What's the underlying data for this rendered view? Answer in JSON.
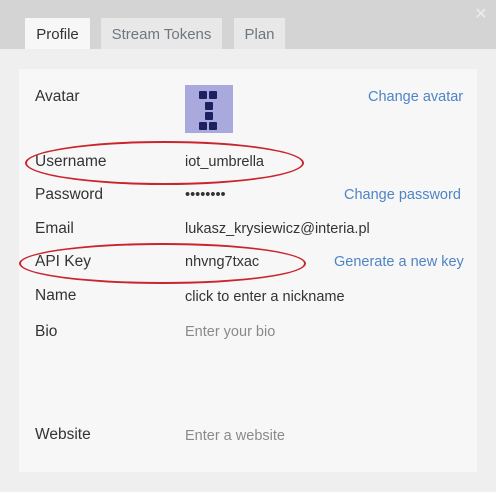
{
  "tabs": [
    "Profile",
    "Stream Tokens",
    "Plan"
  ],
  "close_icon": "close-icon",
  "fields": {
    "avatar": {
      "label": "Avatar",
      "action": "Change avatar"
    },
    "username": {
      "label": "Username",
      "value": "iot_umbrella"
    },
    "password": {
      "label": "Password",
      "value": "••••••••",
      "action": "Change password"
    },
    "email": {
      "label": "Email",
      "value": "lukasz_krysiewicz@interia.pl"
    },
    "api_key": {
      "label": "API Key",
      "value": "nhvng7txac",
      "action": "Generate a new key"
    },
    "name": {
      "label": "Name",
      "value": "click to enter a nickname"
    },
    "bio": {
      "label": "Bio",
      "placeholder": "Enter your bio"
    },
    "website": {
      "label": "Website",
      "placeholder": "Enter a website"
    }
  },
  "colors": {
    "link": "#4f84c4",
    "annotation": "#c9252d",
    "avatar_bg": "#a9a9dd",
    "avatar_fg": "#1d2060"
  }
}
